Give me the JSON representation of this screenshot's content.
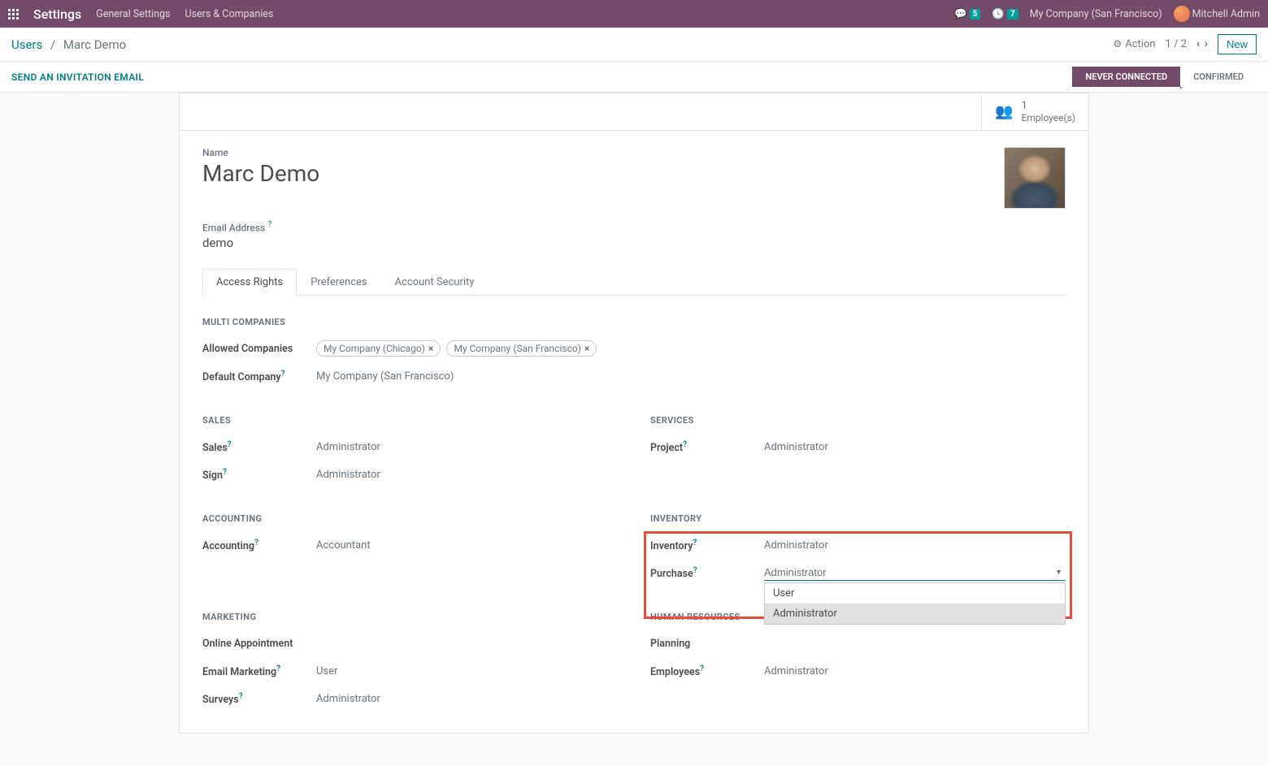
{
  "navbar": {
    "brand": "Settings",
    "links": [
      "General Settings",
      "Users & Companies"
    ],
    "chat_badge": "5",
    "activity_badge": "7",
    "company": "My Company (San Francisco)",
    "user": "Mitchell Admin"
  },
  "breadcrumb": {
    "parent": "Users",
    "current": "Marc Demo",
    "action_label": "Action",
    "pager": "1 / 2",
    "new_btn": "New"
  },
  "statusbar": {
    "invite": "SEND AN INVITATION EMAIL",
    "steps": [
      "NEVER CONNECTED",
      "CONFIRMED"
    ]
  },
  "stat": {
    "count": "1",
    "label": "Employee(s)"
  },
  "form": {
    "name_label": "Name",
    "name_value": "Marc Demo",
    "email_label": "Email Address",
    "email_value": "demo"
  },
  "tabs": [
    "Access Rights",
    "Preferences",
    "Account Security"
  ],
  "sections": {
    "multi_companies": {
      "title": "MULTI COMPANIES",
      "allowed_label": "Allowed Companies",
      "allowed_tags": [
        "My Company (Chicago)",
        "My Company (San Francisco)"
      ],
      "default_label": "Default Company",
      "default_value": "My Company (San Francisco)"
    },
    "sales": {
      "title": "SALES",
      "rows": [
        {
          "label": "Sales",
          "value": "Administrator"
        },
        {
          "label": "Sign",
          "value": "Administrator"
        }
      ]
    },
    "services": {
      "title": "SERVICES",
      "rows": [
        {
          "label": "Project",
          "value": "Administrator"
        }
      ]
    },
    "accounting": {
      "title": "ACCOUNTING",
      "rows": [
        {
          "label": "Accounting",
          "value": "Accountant"
        }
      ]
    },
    "inventory": {
      "title": "INVENTORY",
      "rows": [
        {
          "label": "Inventory",
          "value": "Administrator"
        }
      ],
      "purchase": {
        "label": "Purchase",
        "value": "Administrator",
        "options": [
          "User",
          "Administrator"
        ]
      }
    },
    "marketing": {
      "title": "MARKETING",
      "rows": [
        {
          "label": "Online Appointment",
          "value": ""
        },
        {
          "label": "Email Marketing",
          "value": "User"
        },
        {
          "label": "Surveys",
          "value": "Administrator"
        }
      ]
    },
    "hr": {
      "title": "HUMAN RESOURCES",
      "rows": [
        {
          "label": "Planning",
          "value": ""
        },
        {
          "label": "Employees",
          "value": "Administrator"
        }
      ]
    }
  }
}
